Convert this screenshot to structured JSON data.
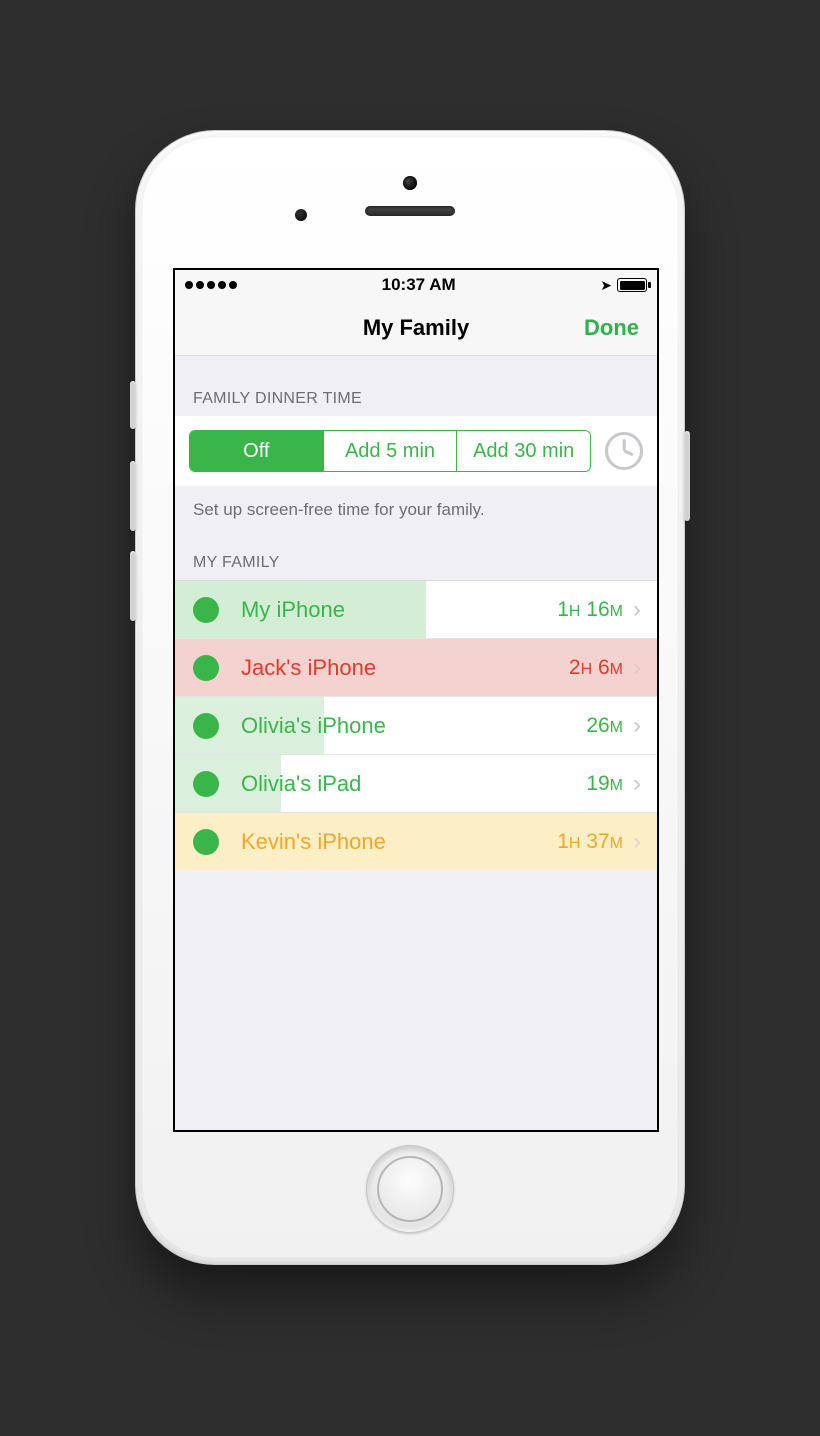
{
  "status": {
    "time": "10:37 AM"
  },
  "nav": {
    "title": "My Family",
    "done": "Done"
  },
  "dinner": {
    "header": "FAMILY DINNER TIME",
    "segments": [
      "Off",
      "Add 5 min",
      "Add 30 min"
    ],
    "selected_index": 0,
    "footer": "Set up screen-free time for your family."
  },
  "family": {
    "header": "MY FAMILY",
    "rows": [
      {
        "name": "My iPhone",
        "time_html": "1<span class='unit'>H</span> 16<span class='unit'>M</span>",
        "color": "green",
        "fill_pct": 52,
        "fill_class": "fill-green",
        "chev_dim": false
      },
      {
        "name": "Jack's iPhone",
        "time_html": "2<span class='unit'>H</span> 6<span class='unit'>M</span>",
        "color": "red",
        "fill_pct": 100,
        "fill_class": "fill-red",
        "chev_dim": true
      },
      {
        "name": "Olivia's iPhone",
        "time_html": "26<span class='unit'>M</span>",
        "color": "green",
        "fill_pct": 31,
        "fill_class": "fill-greenlt",
        "chev_dim": false
      },
      {
        "name": "Olivia's iPad",
        "time_html": "19<span class='unit'>M</span>",
        "color": "green",
        "fill_pct": 22,
        "fill_class": "fill-greenlt",
        "chev_dim": false
      },
      {
        "name": "Kevin's iPhone",
        "time_html": "1<span class='unit'>H</span> 37<span class='unit'>M</span>",
        "color": "amber",
        "fill_pct": 100,
        "fill_class": "fill-amber",
        "chev_dim": true
      }
    ]
  }
}
